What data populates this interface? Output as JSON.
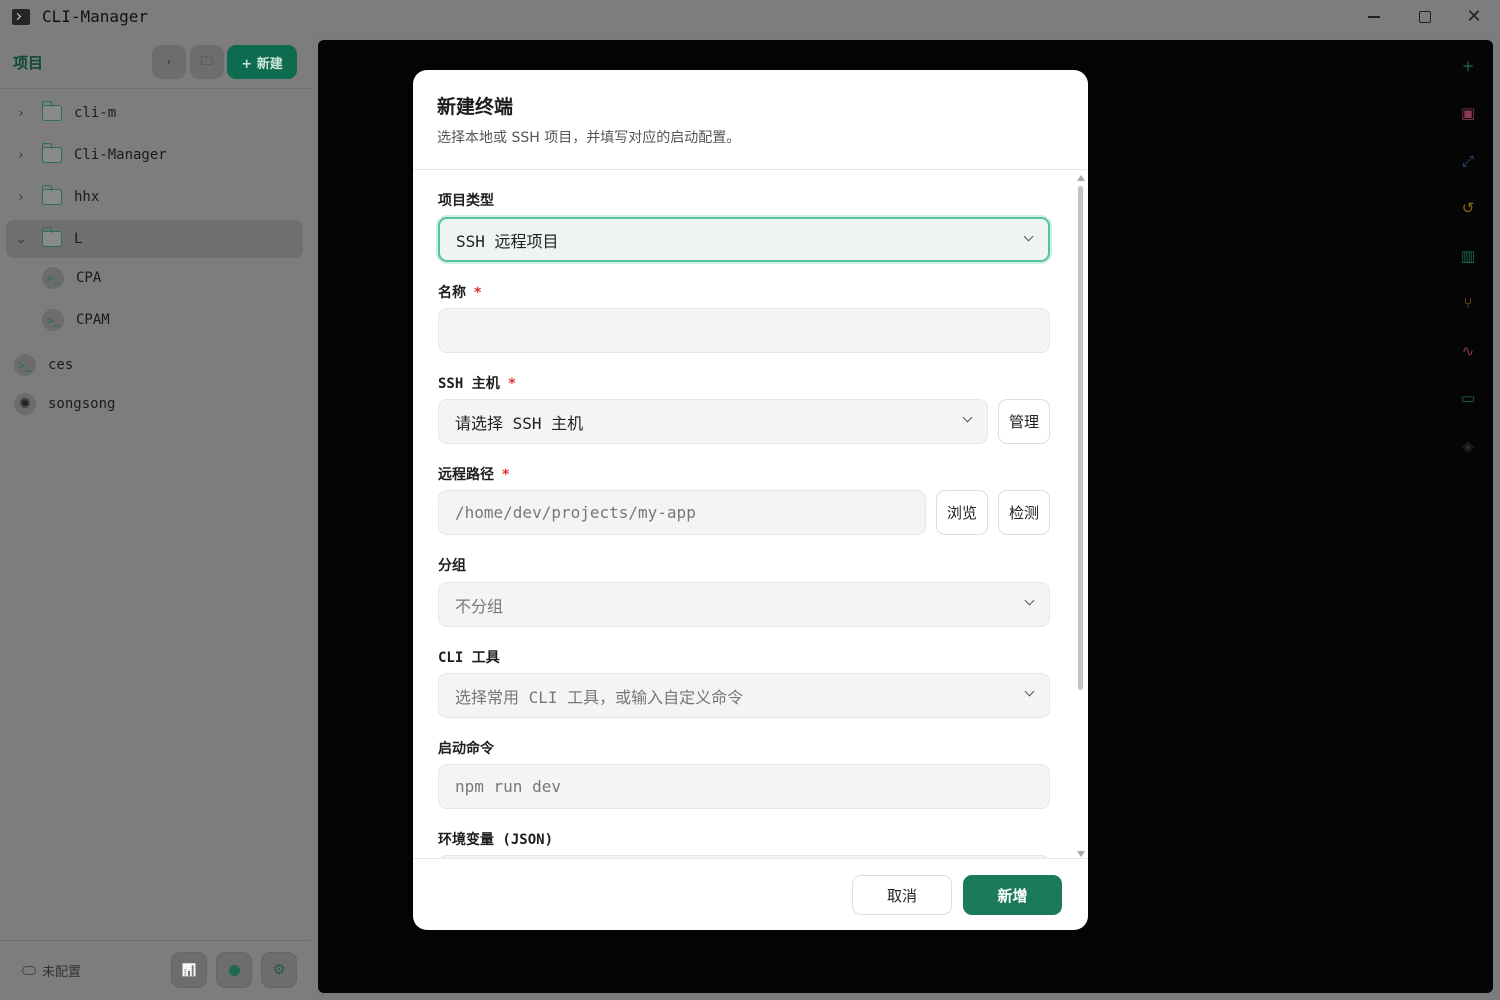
{
  "window": {
    "title": "CLI-Manager",
    "minimize_icon": "minimize-icon",
    "maximize_icon": "maximize-icon",
    "close_glyph": "✕"
  },
  "sidebar": {
    "title": "项目",
    "back_glyph": "‹",
    "folder_glyph": "🗀",
    "new_label": "+ 新建",
    "tree": [
      {
        "label": "cli-m",
        "type": "folder",
        "expanded": false,
        "chev": "›"
      },
      {
        "label": "Cli-Manager",
        "type": "folder",
        "expanded": false,
        "chev": "›"
      },
      {
        "label": "hhx",
        "type": "folder",
        "expanded": false,
        "chev": "›"
      },
      {
        "label": "L",
        "type": "folder",
        "expanded": true,
        "chev": "⌄"
      },
      {
        "label": "CPA",
        "type": "terminal",
        "child": true
      },
      {
        "label": "CPAM",
        "type": "terminal",
        "child": true
      },
      {
        "label": "ces",
        "type": "terminal"
      },
      {
        "label": "songsong",
        "type": "ai"
      }
    ],
    "term_glyph": ">_",
    "ai_glyph": "✺",
    "footer": {
      "status": "未配置",
      "stats_glyph": "📊",
      "gear_glyph": "⚙"
    }
  },
  "right_rail": [
    {
      "icon": "plus-icon",
      "glyph": "+",
      "color": "#1f6a4f"
    },
    {
      "icon": "terminal-icon",
      "glyph": "▣",
      "color": "#8a3a55"
    },
    {
      "icon": "expand-icon",
      "glyph": "⤢",
      "color": "#2c4f8a"
    },
    {
      "icon": "history-icon",
      "glyph": "↺",
      "color": "#8a6a10"
    },
    {
      "icon": "chart-icon",
      "glyph": "▥",
      "color": "#1f6a4f"
    },
    {
      "icon": "git-branch-icon",
      "glyph": "⑂",
      "color": "#8a6a10"
    },
    {
      "icon": "activity-icon",
      "glyph": "∿",
      "color": "#8a3a55"
    },
    {
      "icon": "folder-icon",
      "glyph": "▭",
      "color": "#1f6a4f"
    },
    {
      "icon": "layers-icon",
      "glyph": "◈",
      "color": "#2a2a2a"
    }
  ],
  "modal": {
    "title": "新建终端",
    "subtitle": "选择本地或 SSH 项目，并填写对应的启动配置。",
    "project_type": {
      "label": "项目类型",
      "value": "SSH 远程项目"
    },
    "name": {
      "label": "名称",
      "required": "*",
      "value": ""
    },
    "ssh_host": {
      "label": "SSH 主机",
      "required": "*",
      "placeholder": "请选择 SSH 主机",
      "manage_label": "管理"
    },
    "remote_path": {
      "label": "远程路径",
      "required": "*",
      "placeholder": "/home/dev/projects/my-app",
      "browse_label": "浏览",
      "detect_label": "检测"
    },
    "group": {
      "label": "分组",
      "placeholder": "不分组"
    },
    "cli_tool": {
      "label": "CLI 工具",
      "placeholder": "选择常用 CLI 工具，或输入自定义命令"
    },
    "start_command": {
      "label": "启动命令",
      "placeholder": "npm run dev"
    },
    "env_vars": {
      "label": "环境变量 (JSON)"
    },
    "cancel_label": "取消",
    "submit_label": "新增"
  }
}
